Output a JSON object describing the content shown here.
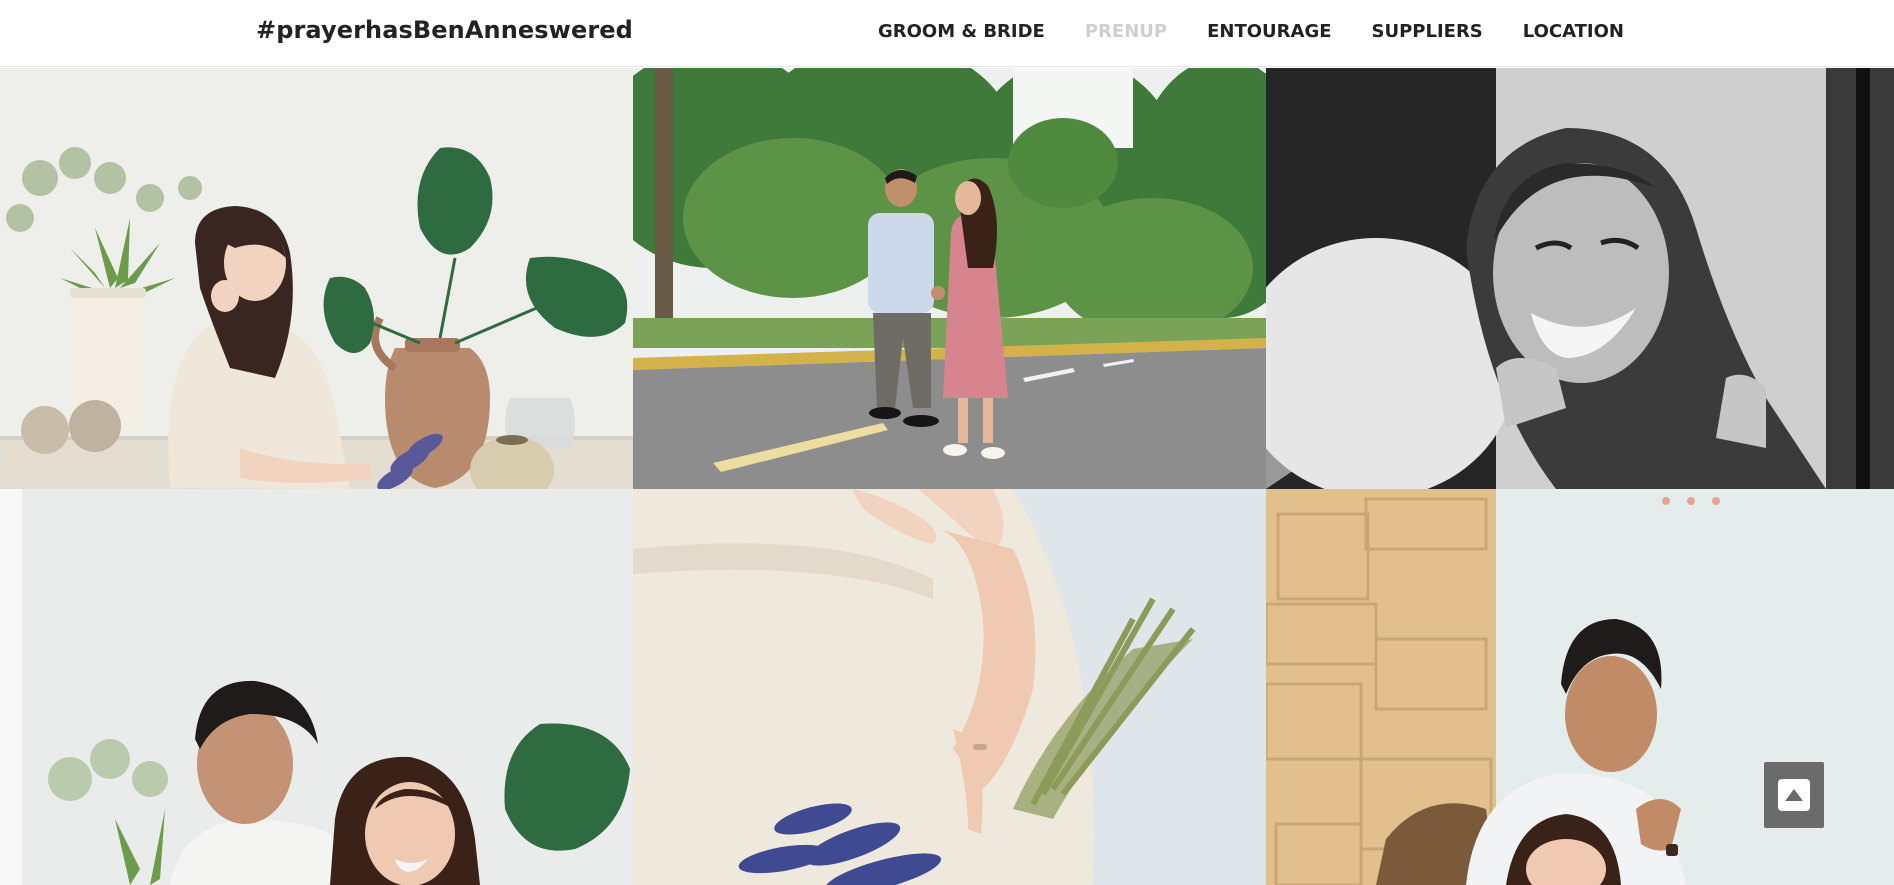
{
  "header": {
    "brand": "#prayerhasBenAnneswered",
    "nav": [
      {
        "label": "GROOM & BRIDE",
        "active": false
      },
      {
        "label": "PRENUP",
        "active": true
      },
      {
        "label": "ENTOURAGE",
        "active": false
      },
      {
        "label": "SUPPLIERS",
        "active": false
      },
      {
        "label": "LOCATION",
        "active": false
      }
    ]
  },
  "gallery": {
    "photos": [
      {
        "subject": "bride-seated-with-plants",
        "tone": "color"
      },
      {
        "subject": "couple-walking-on-road",
        "tone": "color"
      },
      {
        "subject": "bride-smiling-closeup",
        "tone": "black-and-white"
      },
      {
        "subject": "couple-portrait-with-plants",
        "tone": "color"
      },
      {
        "subject": "hands-with-lavender-bouquet",
        "tone": "color"
      },
      {
        "subject": "couple-by-wooden-wall",
        "tone": "color"
      }
    ]
  },
  "back_to_top": {
    "icon": "caret-up-icon"
  },
  "colors": {
    "nav_text": "#222222",
    "nav_active": "#cfcfcf",
    "back_to_top_bg": "#6b6b6b"
  }
}
